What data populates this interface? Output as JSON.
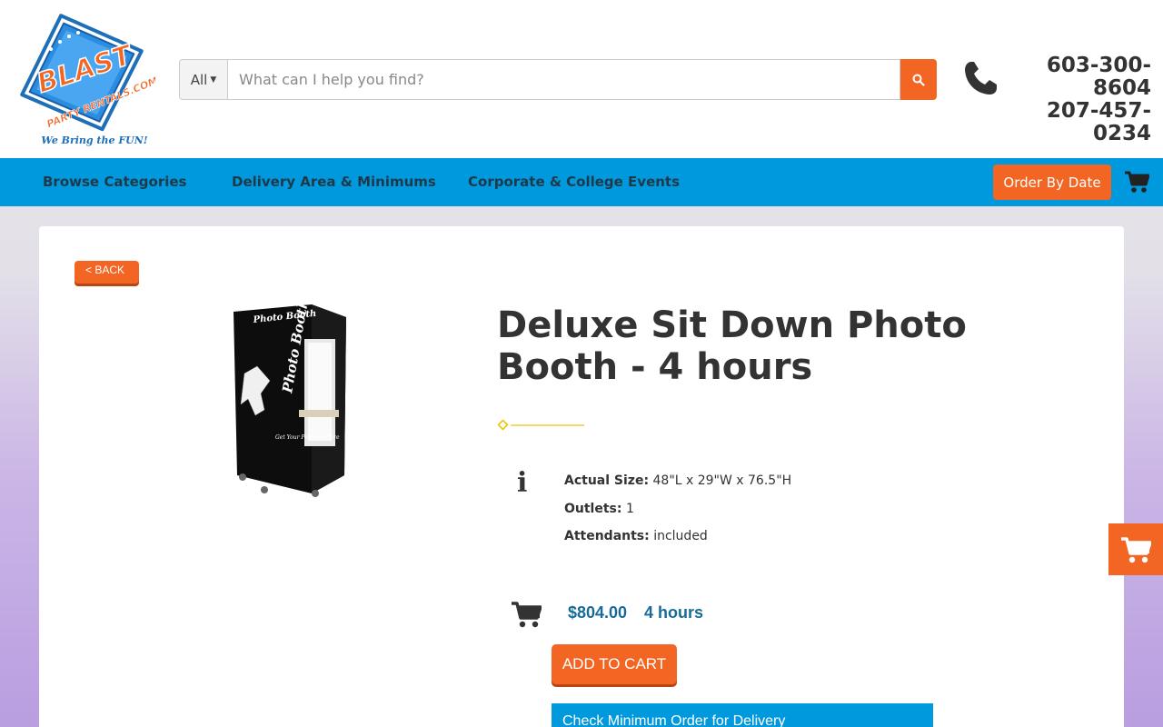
{
  "brand": {
    "logo_word": "BLAST",
    "logo_sub": "PARTY RENTALS.COM",
    "tagline": "We Bring the FUN!"
  },
  "search": {
    "category": "All",
    "placeholder": "What can I help you find?"
  },
  "contact": {
    "phone_1": "603-300-8604",
    "phone_2": "207-457-0234"
  },
  "nav": {
    "items": [
      {
        "label": "Browse Categories"
      },
      {
        "label": "Delivery Area & Minimums"
      },
      {
        "label": "Corporate & College Events"
      }
    ],
    "order_button": "Order By Date"
  },
  "product": {
    "back_label": "< BACK",
    "title": "Deluxe Sit Down Photo Booth - 4 hours",
    "specs": [
      {
        "label": "Actual Size:",
        "value": "48\"L x 29\"W x 76.5\"H"
      },
      {
        "label": "Outlets:",
        "value": "1"
      },
      {
        "label": "Attendants:",
        "value": "included"
      }
    ],
    "price": "$804.00",
    "duration": "4 hours",
    "add_to_cart": "ADD TO CART",
    "check_minimum": "Check Minimum Order for Delivery",
    "image_text": {
      "side_title": "Photo Booth",
      "front_title": "Photo Booth",
      "front_sub": "Get Your Pictures Here"
    }
  },
  "colors": {
    "accent": "#f26522",
    "nav": "#0099dd",
    "price": "#176b99",
    "divider": "#f0c400"
  }
}
